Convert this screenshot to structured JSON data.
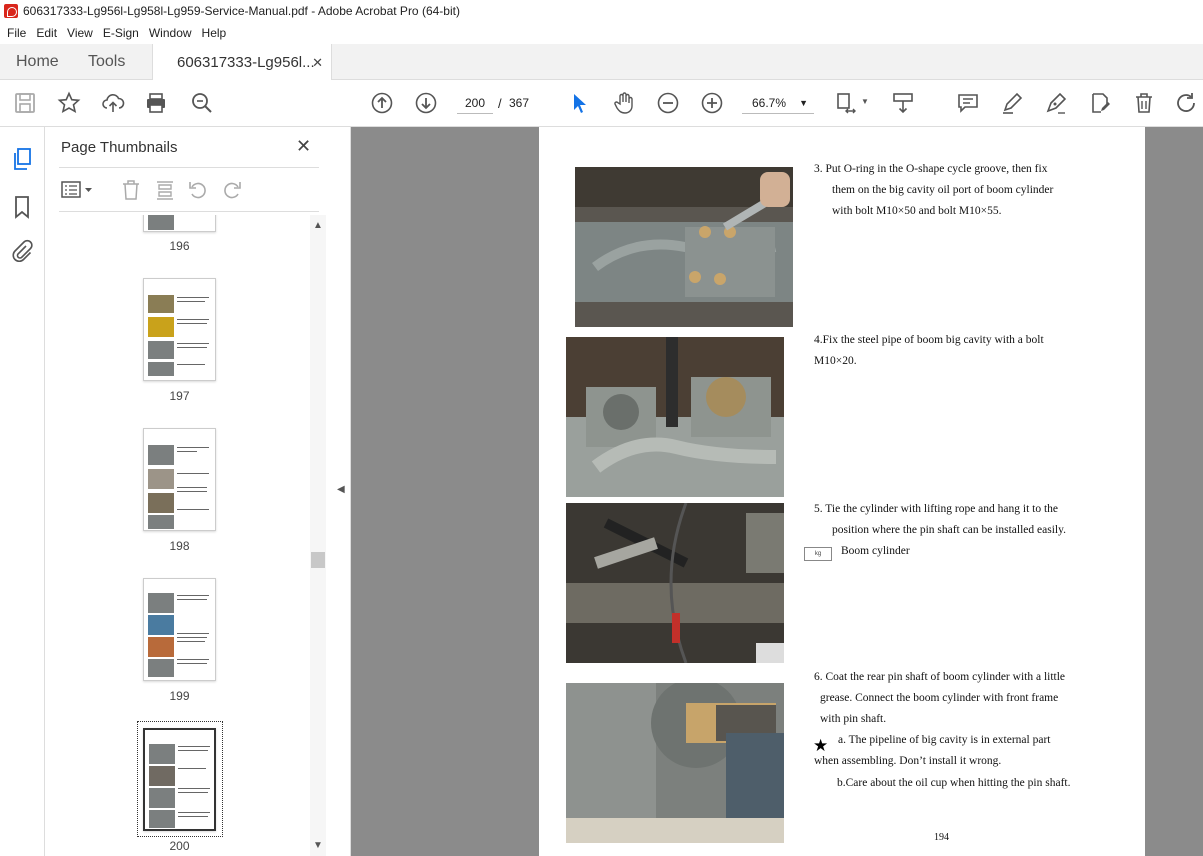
{
  "window": {
    "title": "606317333-Lg956l-Lg958l-Lg959-Service-Manual.pdf - Adobe Acrobat Pro (64-bit)"
  },
  "menu": [
    "File",
    "Edit",
    "View",
    "E-Sign",
    "Window",
    "Help"
  ],
  "tabs": {
    "home": "Home",
    "tools": "Tools",
    "doc": "606317333-Lg956l..."
  },
  "toolbar": {
    "page_current": "200",
    "page_sep": "/",
    "page_total": "367",
    "zoom": "66.7%"
  },
  "panel": {
    "title": "Page Thumbnails",
    "thumbs": [
      "196",
      "197",
      "198",
      "199",
      "200"
    ]
  },
  "document": {
    "step3": [
      "3.   Put O-ring  in the O-shape cycle groove, then fix",
      "them on the big cavity oil port of boom cylinder",
      "with bolt M10×50 and bolt M10×55."
    ],
    "step4": [
      "4.Fix the steel pipe of boom big cavity with a bolt",
      "M10×20."
    ],
    "step5": [
      "5. Tie the cylinder with lifting rope and hang it to the",
      "position where the pin shaft can be installed easily."
    ],
    "step5_note": "Boom cylinder",
    "weight_label": "kg",
    "step6": [
      "6. Coat the rear pin shaft of boom cylinder with a little",
      "grease. Connect the boom cylinder with front frame",
      "with pin shaft."
    ],
    "star": "★",
    "note_a": "a. The pipeline of big cavity is in external part",
    "note_a2": "when assembling. Don’t install it wrong.",
    "note_b": "b.Care about the oil cup when hitting the pin shaft.",
    "page_number": "194"
  }
}
